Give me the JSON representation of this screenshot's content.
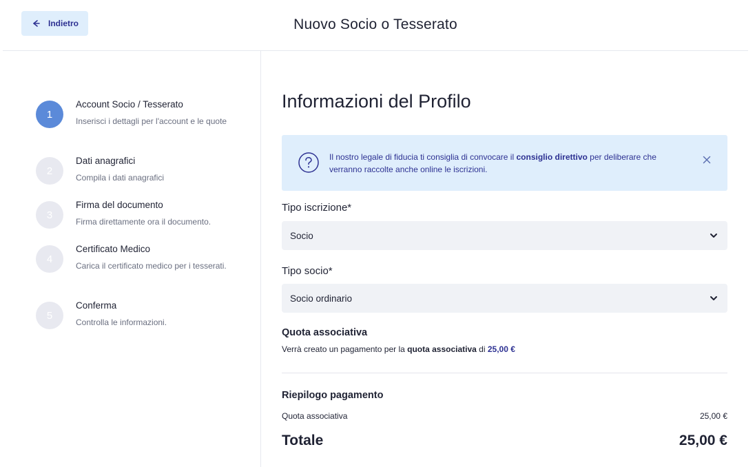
{
  "header": {
    "back_label": "Indietro",
    "title": "Nuovo Socio o Tesserato"
  },
  "steps": [
    {
      "number": "1",
      "title": "Account Socio / Tesserato",
      "description": "Inserisci i dettagli per l'account e le quote",
      "active": true
    },
    {
      "number": "2",
      "title": "Dati anagrafici",
      "description": "Compila i dati anagrafici",
      "active": false
    },
    {
      "number": "3",
      "title": "Firma del documento",
      "description": "Firma direttamente ora il documento.",
      "active": false
    },
    {
      "number": "4",
      "title": "Certificato Medico",
      "description": "Carica il certificato medico per i tesserati.",
      "active": false
    },
    {
      "number": "5",
      "title": "Conferma",
      "description": "Controlla le informazioni.",
      "active": false
    }
  ],
  "main": {
    "section_title": "Informazioni del Profilo",
    "alert": {
      "text_before": "Il nostro legale di fiducia ti consiglia di convocare il ",
      "text_bold": "consiglio direttivo",
      "text_after": " per deliberare che verranno raccolte anche online le iscrizioni."
    },
    "tipo_iscrizione": {
      "label": "Tipo iscrizione*",
      "value": "Socio"
    },
    "tipo_socio": {
      "label": "Tipo socio*",
      "value": "Socio ordinario"
    },
    "quota": {
      "title": "Quota associativa",
      "text_before": "Verrà creato un pagamento per la ",
      "text_bold": "quota associativa",
      "text_mid": " di ",
      "amount": "25,00 €"
    },
    "summary": {
      "title": "Riepilogo pagamento",
      "row_label": "Quota associativa",
      "row_value": "25,00 €",
      "total_label": "Totale",
      "total_value": "25,00 €"
    }
  },
  "colors": {
    "accent": "#2d3192",
    "active_step": "#5b8ad9",
    "alert_bg": "#dfeefc",
    "select_bg": "#f0f2f6"
  }
}
